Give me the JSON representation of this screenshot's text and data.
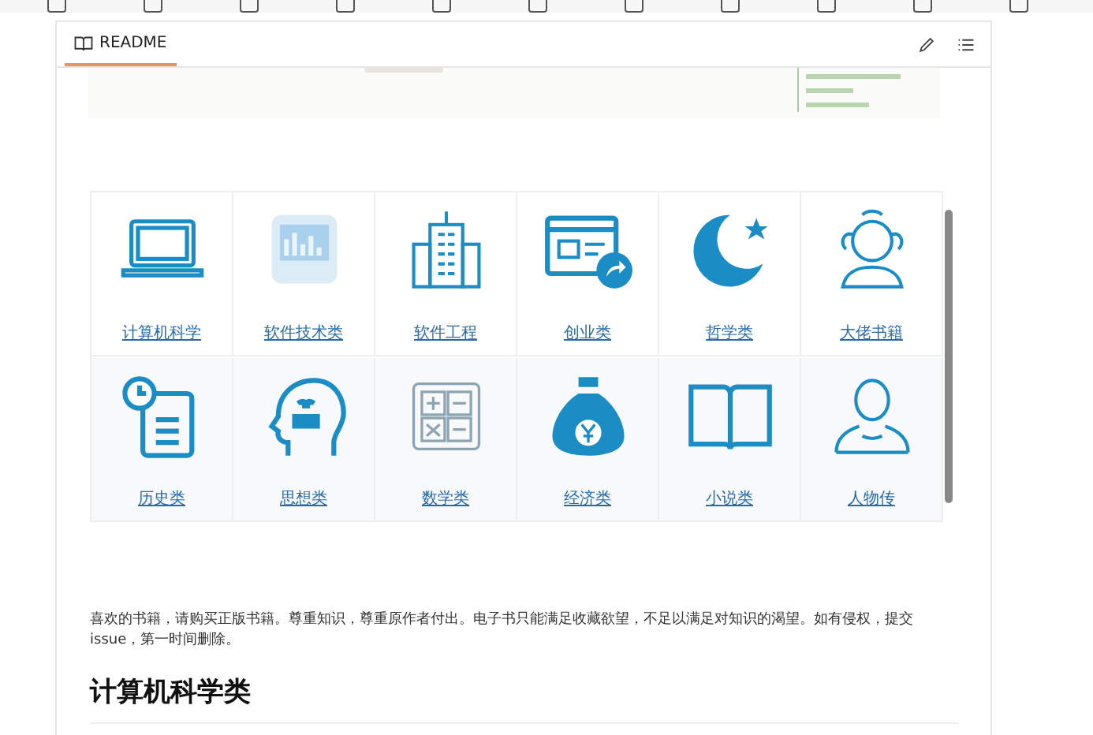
{
  "readme": {
    "tab": "README"
  },
  "categories": [
    {
      "label": "计算机科学"
    },
    {
      "label": "软件技术类"
    },
    {
      "label": "软件工程"
    },
    {
      "label": "创业类"
    },
    {
      "label": "哲学类"
    },
    {
      "label": "大佬书籍"
    },
    {
      "label": "历史类"
    },
    {
      "label": "思想类"
    },
    {
      "label": "数学类"
    },
    {
      "label": "经济类"
    },
    {
      "label": "小说类"
    },
    {
      "label": "人物传"
    }
  ],
  "notice": "喜欢的书籍，请购买正版书籍。尊重知识，尊重原作者付出。电子书只能满足收藏欲望，不足以满足对知识的渴望。如有侵权，提交issue，第一时间删除。",
  "heading": "计算机科学类"
}
